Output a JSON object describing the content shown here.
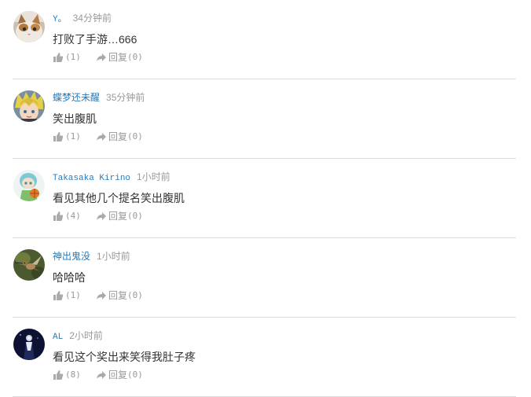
{
  "comments": [
    {
      "username": "Y。",
      "time": "34分钟前",
      "text": "打败了手游…666",
      "likes": "(1)",
      "reply_label": "回复",
      "replies": "(0)",
      "avatar_icon": "cat-avatar-icon"
    },
    {
      "username": "蝶梦还未醒",
      "time": "35分钟前",
      "text": "笑出腹肌",
      "likes": "(1)",
      "reply_label": "回复",
      "replies": "(0)",
      "avatar_icon": "anime-blonde-avatar-icon"
    },
    {
      "username": "Takasaka Kirino",
      "time": "1小时前",
      "text": "看见其他几个提名笑出腹肌",
      "likes": "(4)",
      "reply_label": "回复",
      "replies": "(0)",
      "avatar_icon": "anime-basketball-avatar-icon"
    },
    {
      "username": "神出鬼没",
      "time": "1小时前",
      "text": "哈哈哈",
      "likes": "(1)",
      "reply_label": "回复",
      "replies": "(0)",
      "avatar_icon": "hummingbird-avatar-icon"
    },
    {
      "username": "AL",
      "time": "2小时前",
      "text": "看见这个奖出来笑得我肚子疼",
      "likes": "(8)",
      "reply_label": "回复",
      "replies": "(0)",
      "avatar_icon": "dark-figure-avatar-icon"
    }
  ],
  "colors": {
    "username": "#2a7ab8",
    "meta": "#999999",
    "text": "#333333",
    "divider": "#dcdcdc"
  }
}
